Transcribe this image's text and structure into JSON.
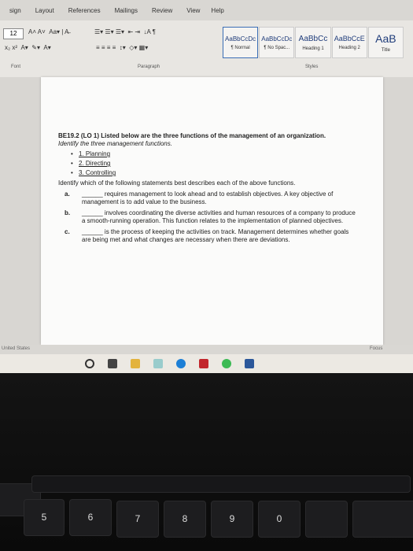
{
  "menu": [
    "sign",
    "Layout",
    "References",
    "Mailings",
    "Review",
    "View",
    "Help"
  ],
  "ribbon": {
    "font_size": "12",
    "styles": [
      {
        "sample": "AaBbCcDc",
        "name": "¶ Normal"
      },
      {
        "sample": "AaBbCcDc",
        "name": "¶ No Spac..."
      },
      {
        "sample": "AaBbCc",
        "name": "Heading 1"
      },
      {
        "sample": "AaBbCcE",
        "name": "Heading 2"
      },
      {
        "sample": "AaB",
        "name": "Title"
      }
    ],
    "groups": {
      "font": "Font",
      "paragraph": "Paragraph",
      "styles": "Styles"
    }
  },
  "doc": {
    "title": "BE19.2 (LO 1) Listed below are the three functions of the management of an organization.",
    "instruction1": "Identify the three management functions.",
    "functions": [
      "1. Planning",
      "2. Directing",
      "3. Controlling"
    ],
    "instruction2": "Identify which of the following statements best describes each of the above functions.",
    "options": [
      {
        "marker": "a.",
        "text": "______ requires management to look ahead and to establish objectives. A key objective of management is to add value to the business."
      },
      {
        "marker": "b.",
        "text": "______ involves coordinating the diverse activities and human resources of a company to produce a smooth-running operation. This function relates to the implementation of planned objectives."
      },
      {
        "marker": "c.",
        "text": "______ is the process of keeping the activities on track. Management determines whether goals are being met and what changes are necessary when there are deviations."
      }
    ]
  },
  "status": {
    "language": "United States",
    "focus": "Focus"
  },
  "keyboard_row": [
    "5",
    "6",
    "7",
    "8",
    "9",
    "0"
  ]
}
